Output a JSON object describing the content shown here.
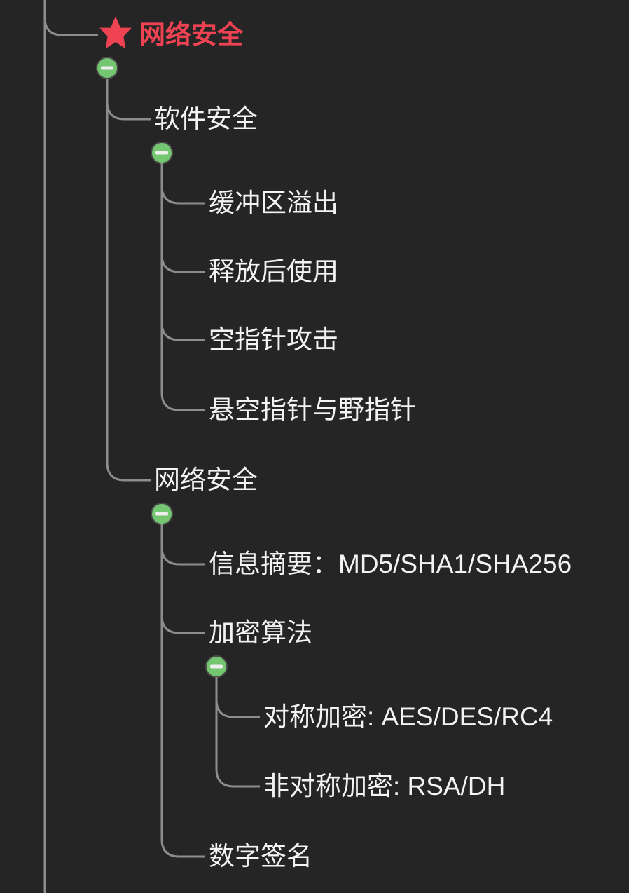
{
  "colors": {
    "background": "#252525",
    "connector": "#8d8d8d",
    "rootText": "#ef4353",
    "childText": "#f3f3f3",
    "starFill": "#ef4353",
    "toggleFill": "#74c671",
    "toggleMinus": "#eeeeee",
    "toggleRing": "#4a4a4a"
  },
  "root": {
    "label": "网络安全",
    "children": [
      {
        "label": "软件安全",
        "children": [
          {
            "label": "缓冲区溢出"
          },
          {
            "label": "释放后使用"
          },
          {
            "label": "空指针攻击"
          },
          {
            "label": "悬空指针与野指针"
          }
        ]
      },
      {
        "label": "网络安全",
        "children": [
          {
            "label": "信息摘要：MD5/SHA1/SHA256"
          },
          {
            "label": "加密算法",
            "children": [
              {
                "label": "对称加密: AES/DES/RC4"
              },
              {
                "label": "非对称加密: RSA/DH"
              }
            ]
          },
          {
            "label": "数字签名"
          }
        ]
      }
    ]
  }
}
